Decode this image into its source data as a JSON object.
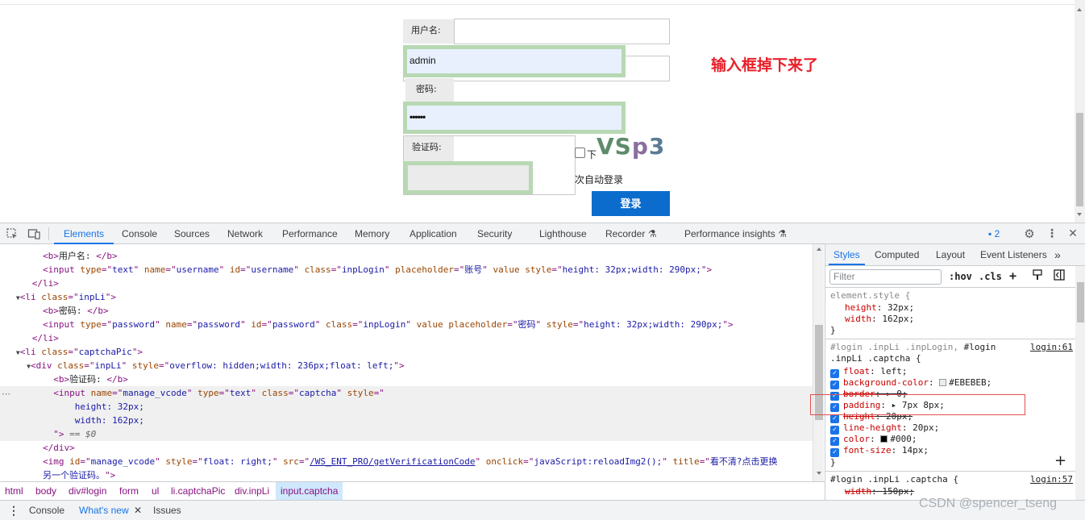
{
  "page": {
    "username_label": "用户名:",
    "username_value": "admin",
    "password_label": "密码:",
    "password_value": "••••••",
    "captcha_label": "验证码:",
    "captcha_text": [
      "V",
      "S",
      "p",
      "3"
    ],
    "remember_text_1": "下",
    "remember_text_2": "次自动登录",
    "login_button": "登录",
    "annotation": "输入框掉下来了"
  },
  "devtools": {
    "tabs": [
      "Elements",
      "Console",
      "Sources",
      "Network",
      "Performance",
      "Memory",
      "Application",
      "Security",
      "Lighthouse",
      "Recorder",
      "Performance insights"
    ],
    "active_tab": "Elements",
    "issues_count": "2"
  },
  "elements": {
    "lines": [
      {
        "indent": "        ",
        "parts": [
          [
            "tag",
            "<b>"
          ],
          [
            "tx",
            "用户名: "
          ],
          [
            "tag",
            "</b>"
          ]
        ]
      },
      {
        "indent": "        ",
        "parts": [
          [
            "tag",
            "<input "
          ],
          [
            "an",
            "type"
          ],
          [
            "tag",
            "=\""
          ],
          [
            "av",
            "text"
          ],
          [
            "tag",
            "\" "
          ],
          [
            "an",
            "name"
          ],
          [
            "tag",
            "=\""
          ],
          [
            "av",
            "username"
          ],
          [
            "tag",
            "\" "
          ],
          [
            "an",
            "id"
          ],
          [
            "tag",
            "=\""
          ],
          [
            "av",
            "username"
          ],
          [
            "tag",
            "\" "
          ],
          [
            "an",
            "class"
          ],
          [
            "tag",
            "=\""
          ],
          [
            "av",
            "inpLogin"
          ],
          [
            "tag",
            "\" "
          ],
          [
            "an",
            "placeholder"
          ],
          [
            "tag",
            "=\""
          ],
          [
            "av",
            "账号"
          ],
          [
            "tag",
            "\" "
          ],
          [
            "an",
            "value"
          ],
          [
            "tag",
            " "
          ],
          [
            "an",
            "style"
          ],
          [
            "tag",
            "=\""
          ],
          [
            "av",
            "height: 32px;width: 290px;"
          ],
          [
            "tag",
            "\">"
          ]
        ]
      },
      {
        "indent": "      ",
        "parts": [
          [
            "tag",
            "</li>"
          ]
        ]
      },
      {
        "indent": "    ",
        "tri": "▼",
        "parts": [
          [
            "tag",
            "<li "
          ],
          [
            "an",
            "class"
          ],
          [
            "tag",
            "=\""
          ],
          [
            "av",
            "inpLi"
          ],
          [
            "tag",
            "\">"
          ]
        ]
      },
      {
        "indent": "        ",
        "parts": [
          [
            "tag",
            "<b>"
          ],
          [
            "tx",
            "密码: "
          ],
          [
            "tag",
            "</b>"
          ]
        ]
      },
      {
        "indent": "        ",
        "parts": [
          [
            "tag",
            "<input "
          ],
          [
            "an",
            "type"
          ],
          [
            "tag",
            "=\""
          ],
          [
            "av",
            "password"
          ],
          [
            "tag",
            "\" "
          ],
          [
            "an",
            "name"
          ],
          [
            "tag",
            "=\""
          ],
          [
            "av",
            "password"
          ],
          [
            "tag",
            "\" "
          ],
          [
            "an",
            "id"
          ],
          [
            "tag",
            "=\""
          ],
          [
            "av",
            "password"
          ],
          [
            "tag",
            "\" "
          ],
          [
            "an",
            "class"
          ],
          [
            "tag",
            "=\""
          ],
          [
            "av",
            "inpLogin"
          ],
          [
            "tag",
            "\" "
          ],
          [
            "an",
            "value"
          ],
          [
            "tag",
            " "
          ],
          [
            "an",
            "placeholder"
          ],
          [
            "tag",
            "=\""
          ],
          [
            "av",
            "密码"
          ],
          [
            "tag",
            "\" "
          ],
          [
            "an",
            "style"
          ],
          [
            "tag",
            "=\""
          ],
          [
            "av",
            "height: 32px;width: 290px;"
          ],
          [
            "tag",
            "\">"
          ]
        ]
      },
      {
        "indent": "      ",
        "parts": [
          [
            "tag",
            "</li>"
          ]
        ]
      },
      {
        "indent": "    ",
        "tri": "▼",
        "parts": [
          [
            "tag",
            "<li "
          ],
          [
            "an",
            "class"
          ],
          [
            "tag",
            "=\""
          ],
          [
            "av",
            "captchaPic"
          ],
          [
            "tag",
            "\">"
          ]
        ]
      },
      {
        "indent": "      ",
        "tri": "▼",
        "parts": [
          [
            "tag",
            "<div "
          ],
          [
            "an",
            "class"
          ],
          [
            "tag",
            "=\""
          ],
          [
            "av",
            "inpLi"
          ],
          [
            "tag",
            "\" "
          ],
          [
            "an",
            "style"
          ],
          [
            "tag",
            "=\""
          ],
          [
            "av",
            "overflow: hidden;width: 236px;float: left;"
          ],
          [
            "tag",
            "\">"
          ]
        ]
      },
      {
        "indent": "          ",
        "parts": [
          [
            "tag",
            "<b>"
          ],
          [
            "tx",
            "验证码: "
          ],
          [
            "tag",
            "</b>"
          ]
        ]
      },
      {
        "indent": "          ",
        "hl": true,
        "parts": [
          [
            "tag",
            "<input "
          ],
          [
            "an",
            "name"
          ],
          [
            "tag",
            "=\""
          ],
          [
            "av",
            "manage_vcode"
          ],
          [
            "tag",
            "\" "
          ],
          [
            "an",
            "type"
          ],
          [
            "tag",
            "=\""
          ],
          [
            "av",
            "text"
          ],
          [
            "tag",
            "\" "
          ],
          [
            "an",
            "class"
          ],
          [
            "tag",
            "=\""
          ],
          [
            "av",
            "captcha"
          ],
          [
            "tag",
            "\" "
          ],
          [
            "an",
            "style"
          ],
          [
            "tag",
            "=\""
          ]
        ]
      },
      {
        "indent": "              ",
        "hl": true,
        "parts": [
          [
            "av",
            "height: 32px;"
          ]
        ]
      },
      {
        "indent": "              ",
        "hl": true,
        "parts": [
          [
            "av",
            "width: 162px;"
          ]
        ]
      },
      {
        "indent": "          ",
        "hl": true,
        "parts": [
          [
            "tag",
            "\">"
          ],
          [
            "eq",
            " == $0"
          ]
        ]
      },
      {
        "indent": "        ",
        "parts": [
          [
            "tag",
            "</div>"
          ]
        ]
      },
      {
        "indent": "        ",
        "parts": [
          [
            "tag",
            "<img "
          ],
          [
            "an",
            "id"
          ],
          [
            "tag",
            "=\""
          ],
          [
            "av",
            "manage_vcode"
          ],
          [
            "tag",
            "\" "
          ],
          [
            "an",
            "style"
          ],
          [
            "tag",
            "=\""
          ],
          [
            "av",
            "float: right;"
          ],
          [
            "tag",
            "\" "
          ],
          [
            "an",
            "src"
          ],
          [
            "tag",
            "=\""
          ],
          [
            "lk",
            "/WS_ENT_PRO/getVerificationCode"
          ],
          [
            "tag",
            "\" "
          ],
          [
            "an",
            "onclick"
          ],
          [
            "tag",
            "=\""
          ],
          [
            "av",
            "javaScript:reloadImg2();"
          ],
          [
            "tag",
            "\" "
          ],
          [
            "an",
            "title"
          ],
          [
            "tag",
            "=\""
          ],
          [
            "av",
            "看不清?点击更换"
          ]
        ]
      },
      {
        "indent": "        ",
        "parts": [
          [
            "av",
            "另一个验证码。"
          ],
          [
            "tag",
            "\">"
          ]
        ]
      }
    ]
  },
  "breadcrumbs": [
    "html",
    "body",
    "div#login",
    "form",
    "ul",
    "li.captchaPic",
    "div.inpLi",
    "input.captcha"
  ],
  "drawer": {
    "console": "Console",
    "whats_new": "What's new",
    "issues": "Issues"
  },
  "watermark": "CSDN @spencer_tseng",
  "styles": {
    "tabs": [
      "Styles",
      "Computed",
      "Layout",
      "Event Listeners"
    ],
    "filter_placeholder": "Filter",
    "hov": ":hov",
    "cls": ".cls",
    "element_style_selector": "element.style {",
    "element_style_props": [
      [
        "height",
        "32px"
      ],
      [
        "width",
        "162px"
      ]
    ],
    "rule2_selector_a": "#login .inpLi .inpLogin, ",
    "rule2_selector_b": "#login",
    "rule2_selector_c": ".inpLi .captcha {",
    "rule2_source": "login:61",
    "rule2_props": [
      {
        "name": "float",
        "value": "left",
        "strike": false
      },
      {
        "name": "background-color",
        "value": "#EBEBEB",
        "strike": false,
        "swatch": "#EBEBEB"
      },
      {
        "name": "border",
        "value": "▸ 0",
        "strike": true
      },
      {
        "name": "padding",
        "value": "▸ 7px 8px",
        "strike": false
      },
      {
        "name": "height",
        "value": "20px",
        "strike": true
      },
      {
        "name": "line-height",
        "value": "20px",
        "strike": false
      },
      {
        "name": "color",
        "value": "#000",
        "strike": false,
        "swatch": "#000000"
      },
      {
        "name": "font-size",
        "value": "14px",
        "strike": false
      }
    ],
    "rule3_selector": "#login .inpLi .captcha {",
    "rule3_source": "login:57",
    "rule3_prop": {
      "name": "width",
      "value": "150px",
      "strike": true
    }
  },
  "colors": {
    "accent": "#1a73e8",
    "login_button": "#0c6ccd",
    "annotation": "#e8202a",
    "input_outline": "#b7d8b3"
  }
}
